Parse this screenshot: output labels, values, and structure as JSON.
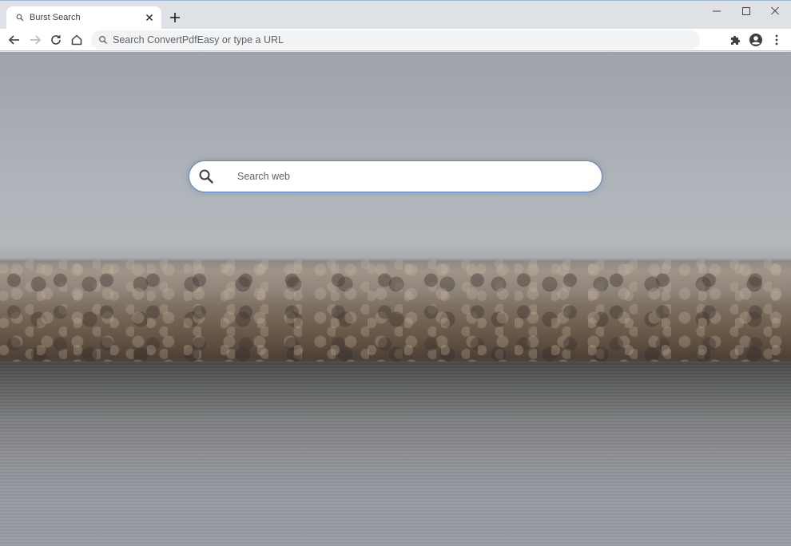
{
  "browser": {
    "tab": {
      "title": "Burst Search",
      "favicon": "search-icon",
      "close_icon": "close-icon"
    },
    "new_tab_icon": "plus-icon",
    "window_controls": [
      "minimize-icon",
      "maximize-icon",
      "close-icon"
    ],
    "toolbar": {
      "back_icon": "arrow-left-icon",
      "forward_icon": "arrow-right-icon",
      "reload_icon": "reload-icon",
      "home_icon": "home-icon",
      "omnibox": {
        "icon": "search-icon",
        "placeholder": "Search ConvertPdfEasy or type a URL",
        "value": ""
      },
      "extensions_icon": "puzzle-icon",
      "profile_icon": "account-circle-icon",
      "menu_icon": "more-vert-icon"
    }
  },
  "page": {
    "background": "rocky shoreline with water under overcast sky",
    "search": {
      "icon": "search-icon",
      "placeholder": "Search web",
      "value": "",
      "border_color": "#5b86c8"
    }
  }
}
